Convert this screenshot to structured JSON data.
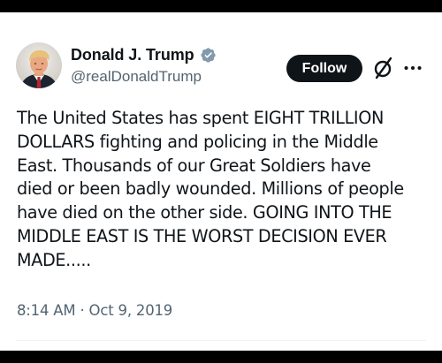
{
  "author": {
    "display_name": "Donald J. Trump",
    "handle": "@realDonaldTrump",
    "avatar_icon": "profile-photo",
    "verified_badge_icon": "verified-check-icon",
    "verified_color": "#829aab"
  },
  "actions": {
    "follow_label": "Follow",
    "grok_icon": "grok-slash-icon",
    "more_icon": "ellipsis-icon"
  },
  "tweet": {
    "lines": [
      "The United States has spent EIGHT TRILLION",
      "DOLLARS fighting and policing in the Middle",
      "East. Thousands of our Great Soldiers have",
      "died or been badly wounded. Millions of people",
      "have died on the other side. GOING INTO THE",
      "MIDDLE EAST IS THE WORST DECISION EVER",
      "MADE....."
    ],
    "timestamp": "8:14 AM · Oct 9, 2019"
  },
  "colors": {
    "text_primary": "#0f1419",
    "text_secondary": "#536471",
    "follow_bg": "#0f1419",
    "follow_text": "#ffffff",
    "background": "#ffffff",
    "letterbox": "#000000"
  }
}
